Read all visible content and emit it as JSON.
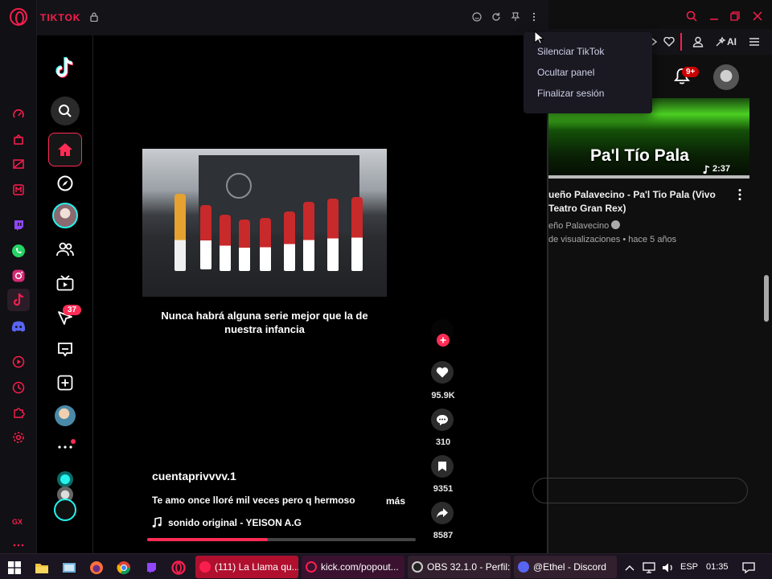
{
  "browser": {
    "panel_title": "TIKTOK"
  },
  "menu": {
    "items": [
      "Silenciar TikTok",
      "Ocultar panel",
      "Finalizar sesión"
    ]
  },
  "tiktok": {
    "nav": {
      "messages_badge": "37"
    },
    "video": {
      "caption": "Nunca habrá alguna serie mejor que la de nuestra infancia",
      "author": "cuentaprivvvv.1",
      "description": "Te amo once lloré mil veces pero q hermoso",
      "more_label": "más",
      "music": "sonido original - YEISON A.G",
      "progress": 0.45
    },
    "actions": {
      "likes": "95.9K",
      "comments": "310",
      "saves": "9351",
      "shares": "8587"
    }
  },
  "youtube": {
    "toolbar_ai": "AI",
    "notifications": "9+",
    "thumbnail_text": "Pa'l Tío Pala",
    "duration": "2:37",
    "video_title": "ueño Palavecino - Pa'l Tio Pala (Vivo Teatro Gran Rex)",
    "channel": "eño Palavecino",
    "meta": "de visualizaciones • hace 5 años"
  },
  "taskbar": {
    "buttons": [
      {
        "label": "(111) La Llama qu...",
        "color": "#b0102e"
      },
      {
        "label": "kick.com/popout...",
        "color": "#3a1230"
      },
      {
        "label": "OBS 32.1.0 - Perfil:...",
        "color": "#33202e"
      },
      {
        "label": "@Ethel - Discord",
        "color": "#33202e"
      }
    ],
    "language": "ESP",
    "time": "01:35"
  },
  "colors": {
    "gx_accent": "#fa1e4e",
    "tiktok_red": "#fe2c55"
  }
}
